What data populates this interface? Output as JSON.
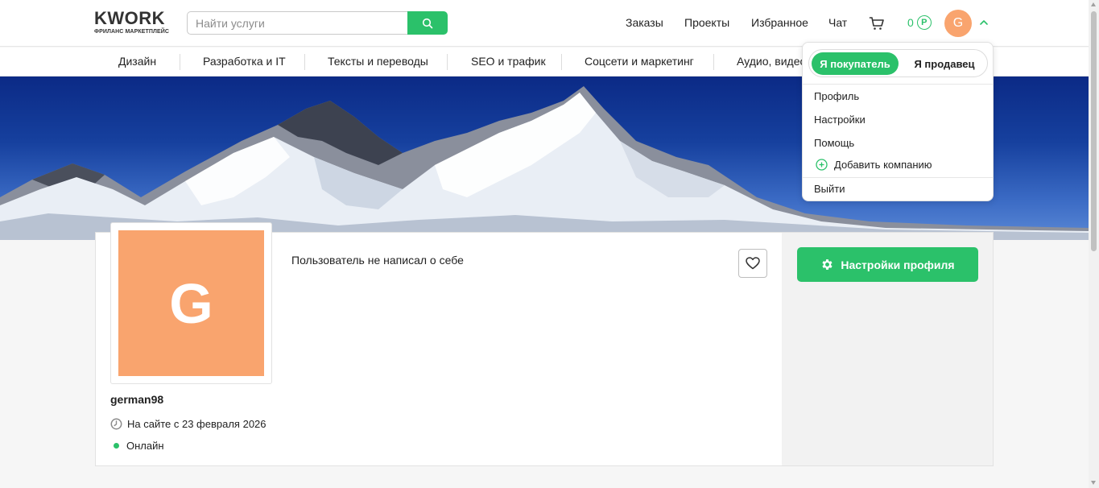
{
  "header": {
    "logo_main": "KWORK",
    "logo_sub": "ФРИЛАНС МАРКЕТПЛЕЙС",
    "search_placeholder": "Найти услуги",
    "nav": [
      "Заказы",
      "Проекты",
      "Избранное",
      "Чат"
    ],
    "balance_value": "0",
    "currency_symbol": "Р",
    "avatar_letter": "G"
  },
  "categories": [
    "Дизайн",
    "Разработка и IT",
    "Тексты и переводы",
    "SEO и трафик",
    "Соцсети и маркетинг",
    "Аудио, видео"
  ],
  "dropdown": {
    "mode_buyer": "Я покупатель",
    "mode_seller": "Я продавец",
    "items": [
      "Профиль",
      "Настройки",
      "Помощь",
      "Добавить компанию"
    ],
    "logout": "Выйти"
  },
  "profile": {
    "avatar_letter": "G",
    "username": "german98",
    "since": "На сайте с 23 февраля 2026",
    "status": "Онлайн",
    "about": "Пользователь не написал о себе",
    "settings_button": "Настройки профиля"
  },
  "colors": {
    "accent": "#2bc16a",
    "avatar_bg": "#f9a46e",
    "logo_accent": "#ff8a00"
  }
}
